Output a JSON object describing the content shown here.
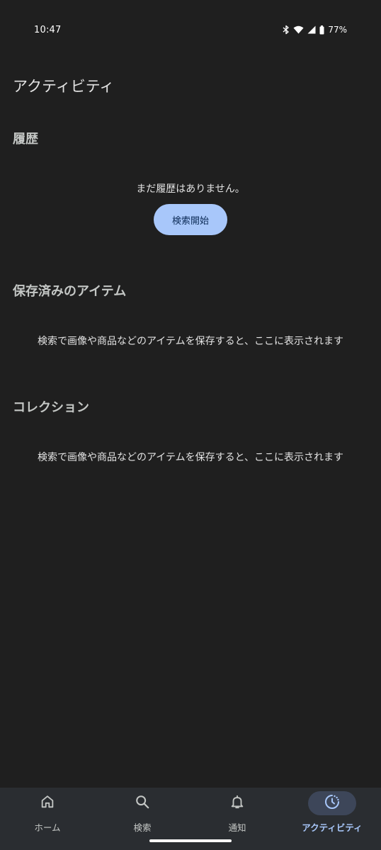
{
  "status_bar": {
    "time": "10:47",
    "battery": "77%",
    "icons": [
      "bluetooth-icon",
      "wifi-icon",
      "signal-icon",
      "battery-icon"
    ]
  },
  "page": {
    "title": "アクティビティ"
  },
  "history": {
    "title": "履歴",
    "empty_text": "まだ履歴はありません。",
    "start_button": "検索開始"
  },
  "saved_items": {
    "title": "保存済みのアイテム",
    "empty_text": "検索で画像や商品などのアイテムを保存すると、ここに表示されます"
  },
  "collections": {
    "title": "コレクション",
    "empty_text": "検索で画像や商品などのアイテムを保存すると、ここに表示されます"
  },
  "bottom_nav": {
    "items": [
      {
        "label": "ホーム",
        "icon": "home-icon",
        "active": false
      },
      {
        "label": "検索",
        "icon": "search-icon",
        "active": false
      },
      {
        "label": "通知",
        "icon": "bell-icon",
        "active": false
      },
      {
        "label": "アクティビティ",
        "icon": "activity-icon",
        "active": true
      }
    ]
  },
  "colors": {
    "background": "#1f1f1f",
    "accent": "#a8c7fa",
    "nav_background": "#2a2d31",
    "active_pill": "#3d4659"
  }
}
